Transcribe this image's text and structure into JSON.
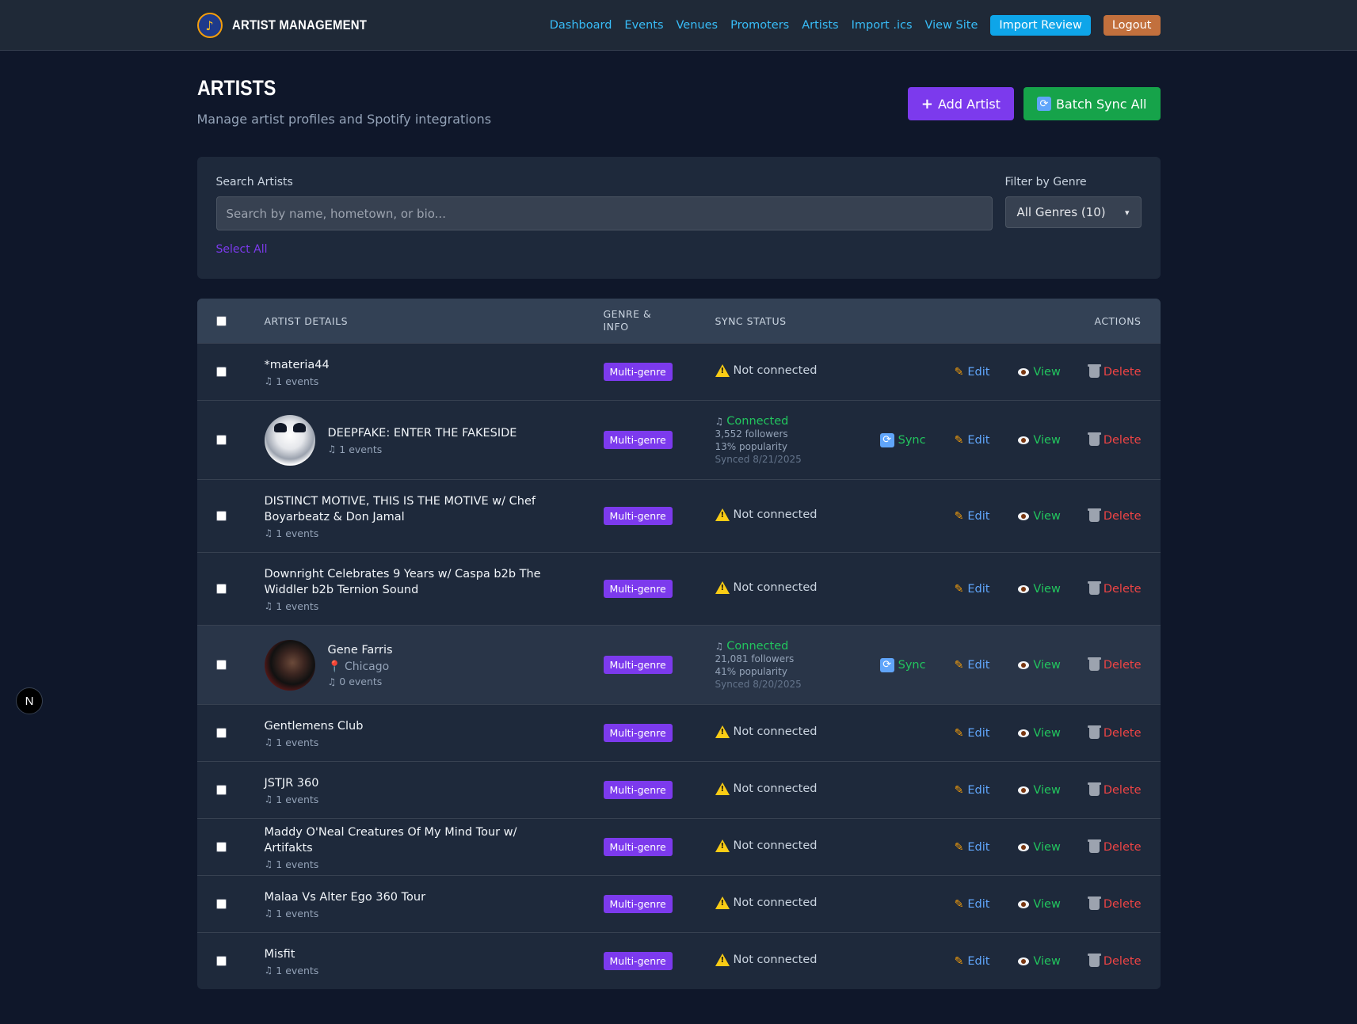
{
  "nav": {
    "brand": "ARTIST MANAGEMENT",
    "links": [
      "Dashboard",
      "Events",
      "Venues",
      "Promoters",
      "Artists",
      "Import .ics",
      "View Site"
    ],
    "import_review": "Import Review",
    "logout": "Logout"
  },
  "header": {
    "title": "ARTISTS",
    "subtitle": "Manage artist profiles and Spotify integrations",
    "add_artist": "Add Artist",
    "batch_sync": "Batch Sync All"
  },
  "filters": {
    "search_label": "Search Artists",
    "search_placeholder": "Search by name, hometown, or bio...",
    "select_all": "Select All",
    "genre_label": "Filter by Genre",
    "genre_selected": "All Genres (10)"
  },
  "table": {
    "columns": [
      "ARTIST DETAILS",
      "GENRE & INFO",
      "SYNC STATUS",
      "ACTIONS"
    ],
    "actions": {
      "sync": "Sync",
      "edit": "Edit",
      "view": "View",
      "delete": "Delete"
    },
    "rows": [
      {
        "name": "*materia44",
        "events": "1 events",
        "genre": "Multi-genre",
        "status": "Not connected"
      },
      {
        "name": "DEEPFAKE: ENTER THE FAKESIDE",
        "events": "1 events",
        "genre": "Multi-genre",
        "status": "Connected",
        "followers": "3,552 followers",
        "popularity": "13% popularity",
        "synced": "Synced 8/21/2025"
      },
      {
        "name": "DISTINCT MOTIVE, THIS IS THE MOTIVE w/ Chef Boyarbeatz & Don Jamal",
        "events": "1 events",
        "genre": "Multi-genre",
        "status": "Not connected"
      },
      {
        "name": "Downright Celebrates 9 Years w/ Caspa b2b The Widdler b2b Ternion Sound",
        "events": "1 events",
        "genre": "Multi-genre",
        "status": "Not connected"
      },
      {
        "name": "Gene Farris",
        "location": "Chicago",
        "events": "0 events",
        "genre": "Multi-genre",
        "status": "Connected",
        "followers": "21,081 followers",
        "popularity": "41% popularity",
        "synced": "Synced 8/20/2025"
      },
      {
        "name": "Gentlemens Club",
        "events": "1 events",
        "genre": "Multi-genre",
        "status": "Not connected"
      },
      {
        "name": "JSTJR 360",
        "events": "1 events",
        "genre": "Multi-genre",
        "status": "Not connected"
      },
      {
        "name": "Maddy O'Neal Creatures Of My Mind Tour w/ Artifakts",
        "events": "1 events",
        "genre": "Multi-genre",
        "status": "Not connected"
      },
      {
        "name": "Malaa Vs Alter Ego 360 Tour",
        "events": "1 events",
        "genre": "Multi-genre",
        "status": "Not connected"
      },
      {
        "name": "Misfit",
        "events": "1 events",
        "genre": "Multi-genre",
        "status": "Not connected"
      }
    ]
  },
  "floating_badge": "N"
}
